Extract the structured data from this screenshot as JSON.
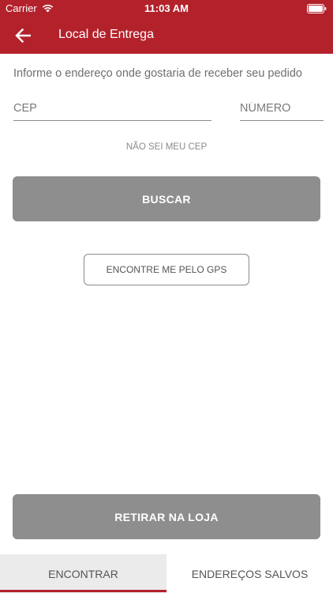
{
  "status_bar": {
    "carrier": "Carrier",
    "time": "11:03 AM"
  },
  "header": {
    "title": "Local de Entrega",
    "back_icon": "arrow-left-icon",
    "background_color": "#b3222b"
  },
  "form": {
    "instruction": "Informe o endereço onde gostaria de receber seu pedido",
    "cep_placeholder": "CEP",
    "numero_placeholder": "NÚMERO",
    "unknown_cep_link": "NÃO SEI MEU CEP",
    "search_button": "BUSCAR",
    "gps_button": "ENCONTRE ME PELO GPS"
  },
  "pickup_button": "RETIRAR NA LOJA",
  "tabs": [
    {
      "label": "ENCONTRAR",
      "active": true
    },
    {
      "label": "ENDEREÇOS SALVOS",
      "active": false
    }
  ],
  "colors": {
    "accent": "#b3222b",
    "button_gray": "#8e8e8e"
  }
}
